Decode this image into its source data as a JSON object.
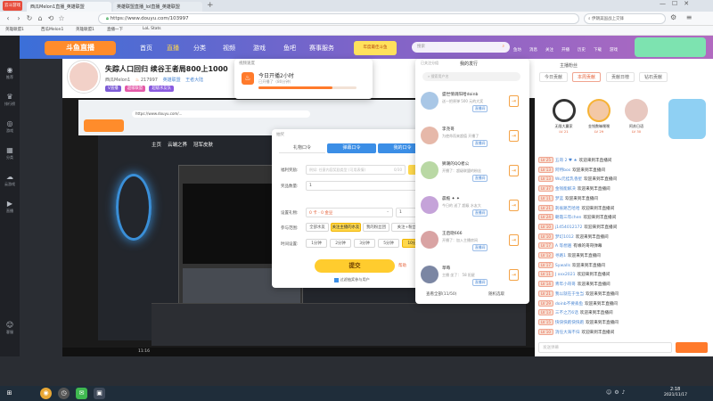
{
  "browser": {
    "tabs": [
      {
        "label": "西瓜Melon1直播_英雄联盟",
        "active": true
      },
      {
        "label": "英雄联盟直播_lol直播_英雄联盟",
        "active": false
      }
    ],
    "url": "https://www.douyu.com/103997",
    "search_placeholder": "伊朗美国战上交锋",
    "bookmarks": [
      "英雄联盟1",
      "西瓜Melon1",
      "英雄联盟1",
      "直播一下",
      "LoL Stats"
    ]
  },
  "sidebar": {
    "badge": "云斗游戏",
    "items": [
      "推荐",
      "排行榜",
      "游戏",
      "分类",
      "云游戏",
      "直播"
    ],
    "bottom": "客服"
  },
  "header": {
    "logo": "斗鱼直播",
    "nav": [
      "首页",
      "直播",
      "分类",
      "视频",
      "游戏",
      "鱼吧",
      "赛事服务"
    ],
    "promo": "年度最佳斗鱼",
    "search_placeholder": "搜索",
    "icons": [
      "鱼坊",
      "消息",
      "关注",
      "开播",
      "历史",
      "下载",
      "游戏"
    ]
  },
  "streamer": {
    "title": "失踪人口回归 续谷王者局800上1000",
    "name": "西瓜Melon1",
    "fans": "217997",
    "tags": [
      "英雄联盟",
      "王者大陆",
      "超级战队"
    ],
    "badges": [
      "V直播",
      "超级联盟",
      "超级水友队"
    ]
  },
  "video": {
    "inner_url": "https://www.douyu.com/...",
    "nav": [
      "主页",
      "云端之界",
      "冠军皮肤"
    ],
    "time": "11:16"
  },
  "popup_timer": {
    "title": "视频速度",
    "text": "今日开播2小时",
    "sub": "已开播了（80分钟）",
    "progress": 0.75
  },
  "popup_gift": {
    "title": "抽奖",
    "tabs": [
      "礼物口令",
      "弹幕口令",
      "我的口令"
    ],
    "fields": [
      {
        "label": "福利奖励:",
        "placeholder": "例如: 任意内容奖励类型 (可用表情)",
        "counter": "0/30"
      },
      {
        "label": "奖品数量:",
        "value": "1"
      }
    ],
    "gift_label": "设置礼物:",
    "gift_value": "0 卡 · 0 金豆",
    "qty": "1",
    "join_label": "参与范围:",
    "join_opts": [
      "全部水友",
      "关注主播的水友",
      "我的粉丝团",
      "关注+粉丝团"
    ],
    "time_label": "时间设置:",
    "time_opts": [
      "1分钟",
      "2分钟",
      "3分钟",
      "5分钟",
      "10分钟"
    ],
    "submit": "提交",
    "help": "帮助",
    "checkbox": "过滤抽奖参与用户"
  },
  "popup_fans": {
    "header": "已关注分组",
    "title": "我的发行",
    "search_placeholder": "搜索用户名",
    "list": [
      {
        "name": "盛世情调阳哈doinb",
        "desc": "送一把原弹 500 元的大奖",
        "tag": "直播间"
      },
      {
        "name": "李尧哥",
        "desc": "为使命而来超值 开播了",
        "tag": "直播间"
      },
      {
        "name": "狮潮的QQ者公",
        "desc": "开播了：超级联盟的粉丝",
        "tag": "直播间"
      },
      {
        "name": "晨栀 ✦ ✦",
        "desc": "今日的 送了 超级 水友大",
        "tag": "直播间"
      },
      {
        "name": "王启晓666",
        "desc": "开播了：加入主播房间",
        "tag": "直播间"
      },
      {
        "name": "草莓",
        "desc": "主播 坐了： 58 阳星",
        "tag": "直播间"
      }
    ],
    "footer_left": "查看全部(11/50)",
    "footer_right": "随机选取"
  },
  "right_panel": {
    "title": "主播粉丝",
    "tabs": [
      "今日贡献",
      "本周贡献",
      "贡献日榜",
      "钻石贡献"
    ],
    "top3": [
      {
        "name": "无限大赢家",
        "level": "LV 21"
      },
      {
        "name": "金钱数嘛嘿嘿",
        "level": "LV 29"
      },
      {
        "name": "阿苏日语",
        "level": "LV 30"
      }
    ],
    "chat": [
      {
        "lv": "LV 25",
        "name": "五哥 2 ♥ ★",
        "text": "欢迎来到丰直播间"
      },
      {
        "lv": "LV 13",
        "name": "阿特bos",
        "text": "欢迎来到丰直播间"
      },
      {
        "lv": "LV 13",
        "name": "Wu元挂乳香星",
        "text": "欢迎来到丰直播间"
      },
      {
        "lv": "LV 37",
        "name": "金钱能解决",
        "text": "欢迎来到丰直播间"
      },
      {
        "lv": "LV 11",
        "name": "梦蓝",
        "text": "欢迎来到丰直播间"
      },
      {
        "lv": "LV 21",
        "name": "刺雀路吉哈哈",
        "text": "欢迎来到丰直播间"
      },
      {
        "lv": "LV 24",
        "name": "朝霞三年chen",
        "text": "欢迎来到丰直播间"
      },
      {
        "lv": "LV 10",
        "name": "j1454012172",
        "text": "欢迎来到丰直播间"
      },
      {
        "lv": "LV 10",
        "name": "梦幻1012",
        "text": "欢迎来到丰直播间"
      },
      {
        "lv": "LV 17",
        "name": "A 等想遍",
        "text": "有缘的哥哥弹幕"
      },
      {
        "lv": "LV 12",
        "name": "寻路1",
        "text": "欢迎来到丰直播间"
      },
      {
        "lv": "LV 17",
        "name": "Sywalls",
        "text": "欢迎来到丰直播间"
      },
      {
        "lv": "LV 11",
        "name": "J xxx2021",
        "text": "欢迎来到丰直播间"
      },
      {
        "lv": "LV 14",
        "name": "青年小哥哥",
        "text": "欢迎来到丰直播间"
      },
      {
        "lv": "LV 21",
        "name": "我以就在于生当",
        "text": "欢迎来到丰直播间"
      },
      {
        "lv": "LV 29",
        "name": "doinb不要丢鱼",
        "text": "欢迎来到丰直播间"
      },
      {
        "lv": "LV 13",
        "name": "三不之万6话",
        "text": "欢迎来到丰直播间"
      },
      {
        "lv": "LV 15",
        "name": "快快快跑快快跑",
        "text": "欢迎来到丰直播间"
      },
      {
        "lv": "LV 10",
        "name": "消任大海不归",
        "text": "欢迎来到丰直播间"
      }
    ],
    "input_placeholder": "发送弹幕"
  },
  "taskbar": {
    "time": "2:18",
    "date": "2021/11/17"
  },
  "colors": {
    "header_start": "#3b6fd8",
    "accent_orange": "#ff7a2b",
    "accent_yellow": "#ffd84c",
    "chat_name": "#4d88d3"
  }
}
